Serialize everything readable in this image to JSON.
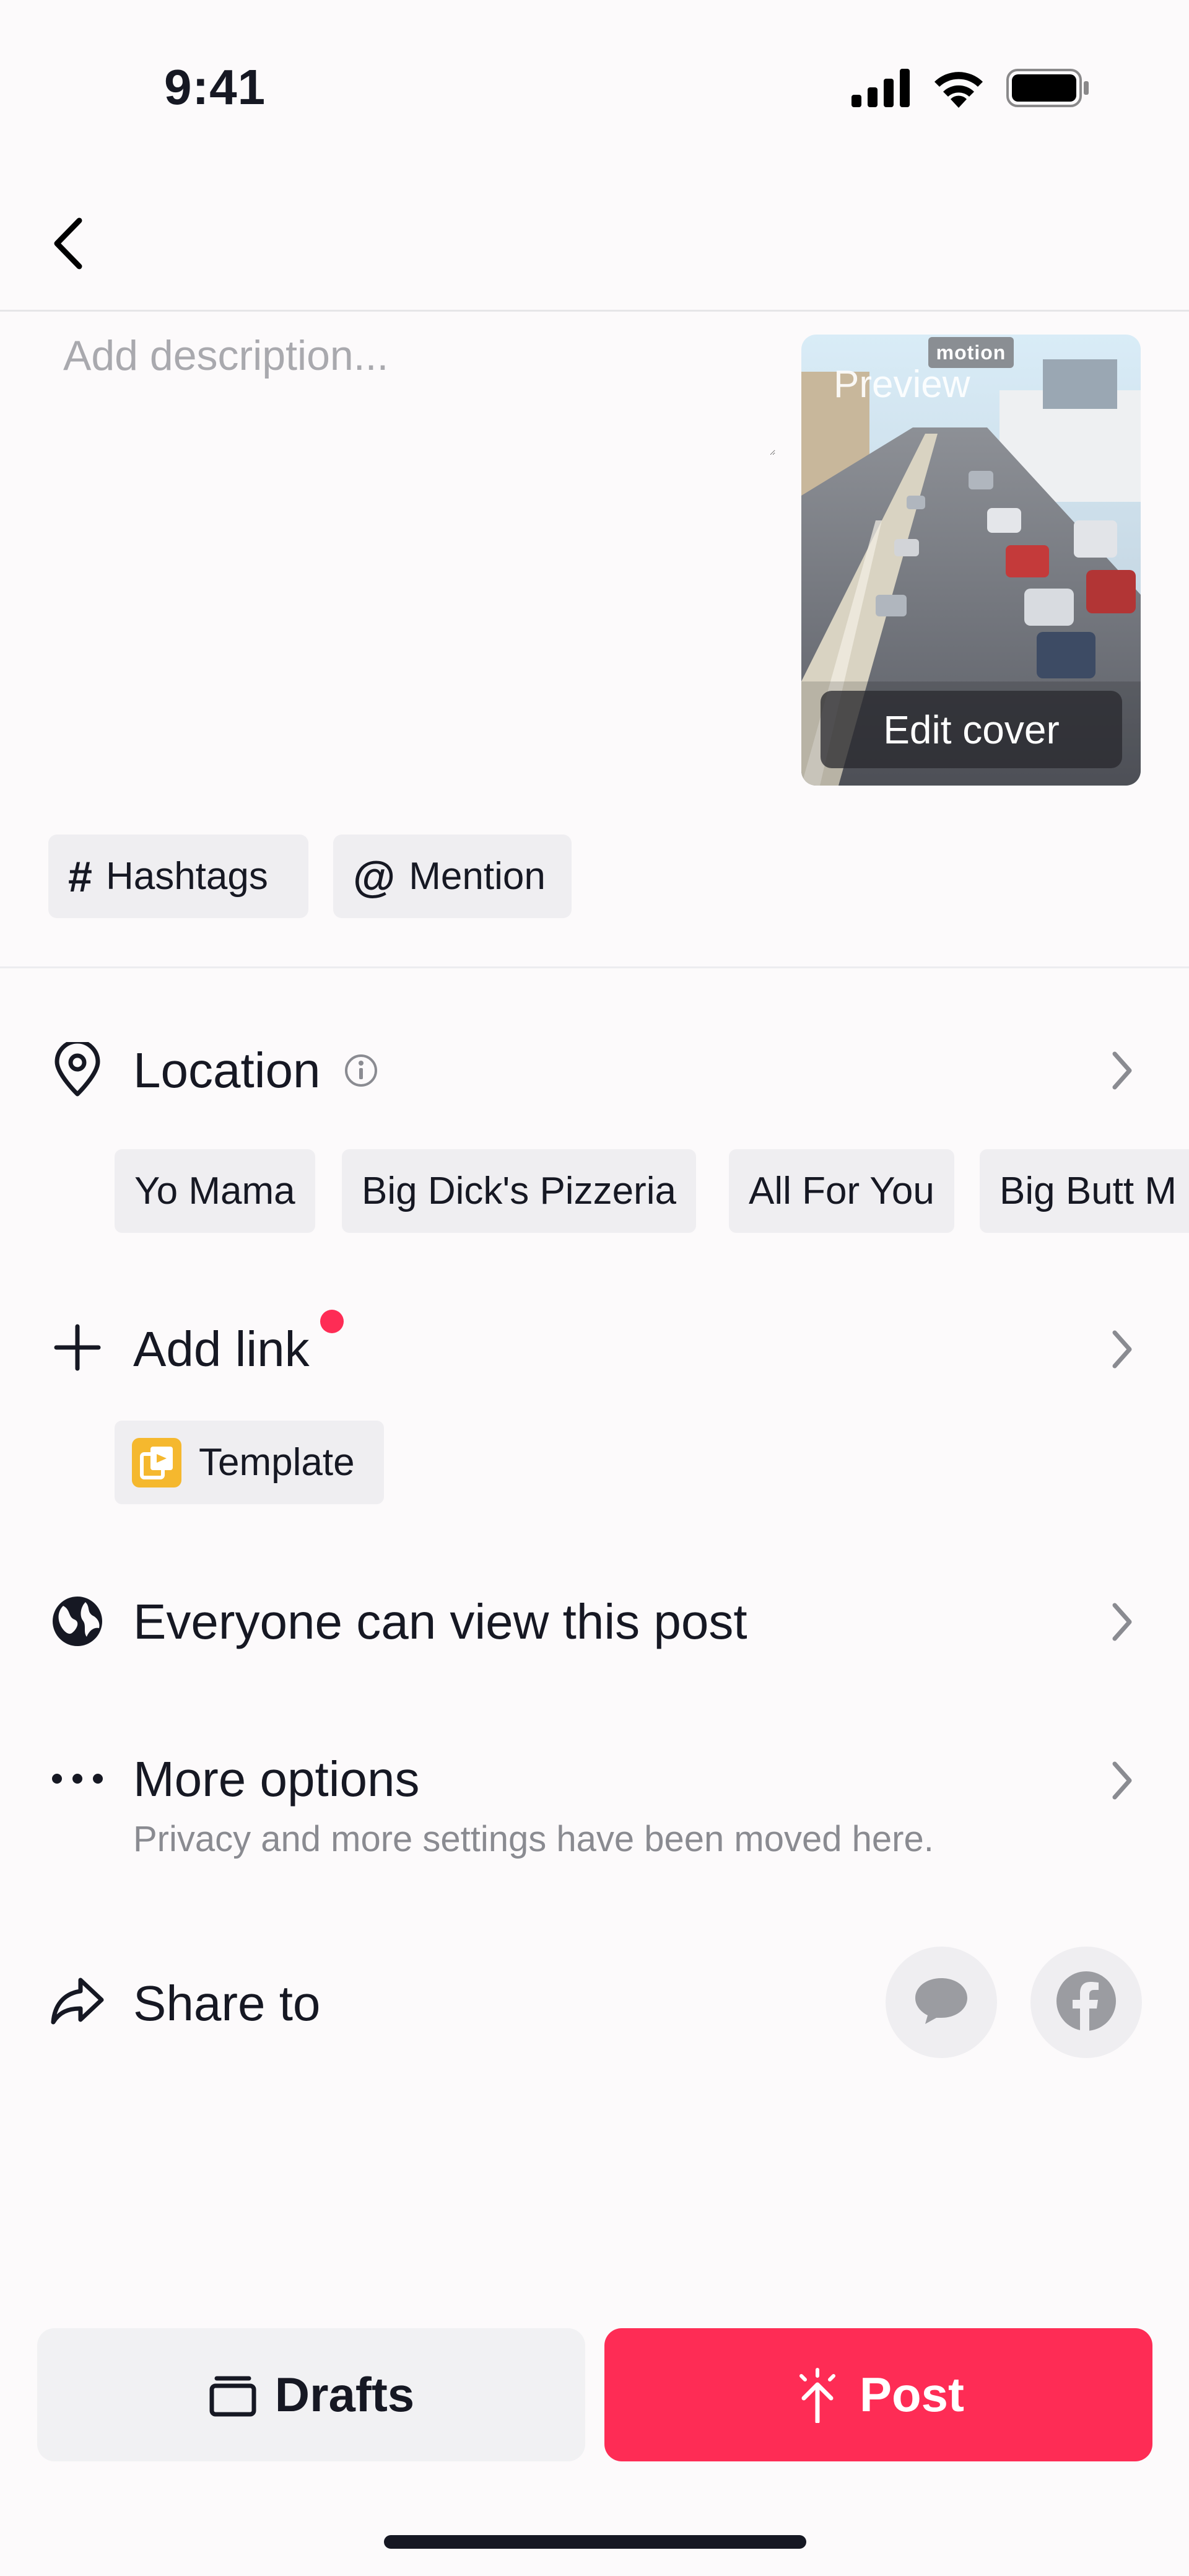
{
  "status_bar": {
    "time": "9:41"
  },
  "description": {
    "placeholder": "Add description..."
  },
  "cover": {
    "badge": "motion",
    "preview_label": "Preview",
    "edit_label": "Edit cover"
  },
  "chips": {
    "hashtags": "Hashtags",
    "mention": "Mention"
  },
  "location": {
    "title": "Location",
    "suggestions": [
      "Yo Mama",
      "Big Dick's Pizzeria",
      "All For You",
      "Big Butt M"
    ]
  },
  "add_link": {
    "title": "Add link",
    "template_label": "Template"
  },
  "visibility": {
    "title": "Everyone can view this post"
  },
  "more_options": {
    "title": "More options",
    "subtitle": "Privacy and more settings have been moved here."
  },
  "share": {
    "title": "Share to",
    "targets": [
      "message-icon",
      "facebook-icon"
    ]
  },
  "actions": {
    "drafts": "Drafts",
    "post": "Post"
  },
  "colors": {
    "accent": "#fe2c55",
    "chip_bg": "#efeef1",
    "text": "#161823",
    "muted": "#8a8b91"
  }
}
